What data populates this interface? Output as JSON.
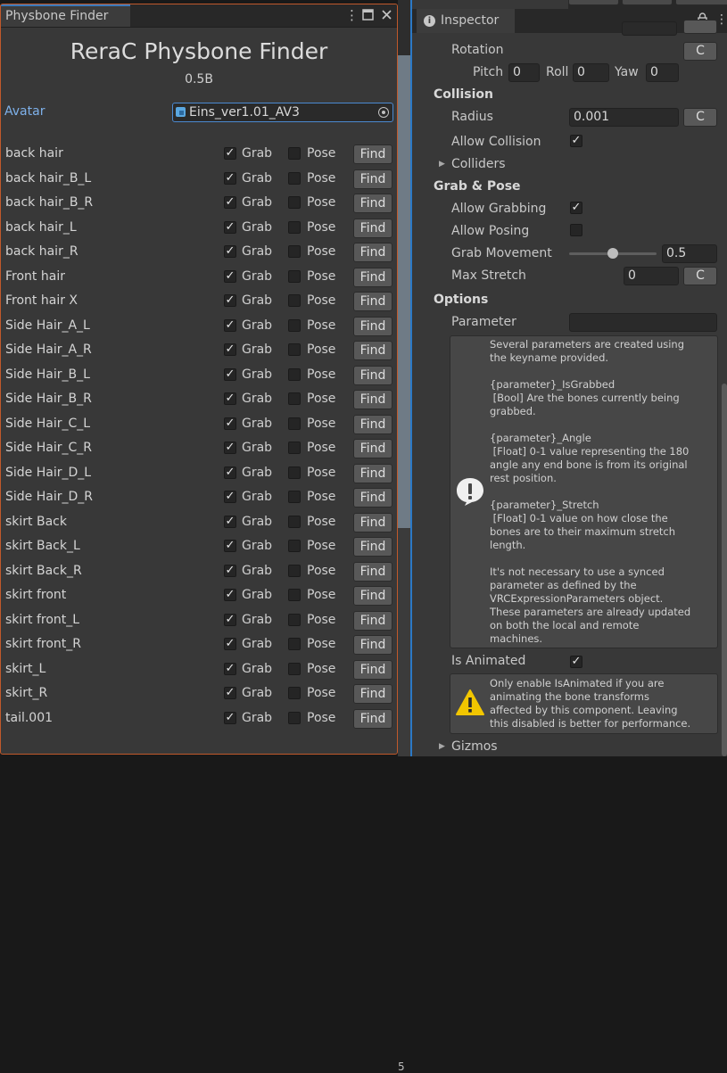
{
  "finder": {
    "tab_title": "Physbone Finder",
    "title": "ReraC Physbone Finder",
    "version": "0.5B",
    "avatar_label": "Avatar",
    "avatar_value": "Eins_ver1.01_AV3",
    "grab_label": "Grab",
    "pose_label": "Pose",
    "find_label": "Find",
    "check_glyph": "✓",
    "rows": [
      {
        "name": "back hair",
        "grab": true,
        "pose": false
      },
      {
        "name": "back hair_B_L",
        "grab": true,
        "pose": false
      },
      {
        "name": "back hair_B_R",
        "grab": true,
        "pose": false
      },
      {
        "name": "back hair_L",
        "grab": true,
        "pose": false
      },
      {
        "name": "back hair_R",
        "grab": true,
        "pose": false
      },
      {
        "name": "Front hair",
        "grab": true,
        "pose": false
      },
      {
        "name": "Front hair X",
        "grab": true,
        "pose": false
      },
      {
        "name": "Side Hair_A_L",
        "grab": true,
        "pose": false
      },
      {
        "name": "Side Hair_A_R",
        "grab": true,
        "pose": false
      },
      {
        "name": "Side Hair_B_L",
        "grab": true,
        "pose": false
      },
      {
        "name": "Side Hair_B_R",
        "grab": true,
        "pose": false
      },
      {
        "name": "Side Hair_C_L",
        "grab": true,
        "pose": false
      },
      {
        "name": "Side Hair_C_R",
        "grab": true,
        "pose": false
      },
      {
        "name": "Side Hair_D_L",
        "grab": true,
        "pose": false
      },
      {
        "name": "Side Hair_D_R",
        "grab": true,
        "pose": false
      },
      {
        "name": "skirt Back",
        "grab": true,
        "pose": false
      },
      {
        "name": "skirt Back_L",
        "grab": true,
        "pose": false
      },
      {
        "name": "skirt Back_R",
        "grab": true,
        "pose": false
      },
      {
        "name": "skirt front",
        "grab": true,
        "pose": false
      },
      {
        "name": "skirt front_L",
        "grab": true,
        "pose": false
      },
      {
        "name": "skirt front_R",
        "grab": true,
        "pose": false
      },
      {
        "name": "skirt_L",
        "grab": true,
        "pose": false
      },
      {
        "name": "skirt_R",
        "grab": true,
        "pose": false
      },
      {
        "name": "tail.001",
        "grab": true,
        "pose": false
      }
    ]
  },
  "scene": {
    "partial_digit": "5"
  },
  "inspector": {
    "tab_title": "Inspector",
    "rotation_label": "Rotation",
    "pitch_label": "Pitch",
    "pitch_value": "0",
    "roll_label": "Roll",
    "roll_value": "0",
    "yaw_label": "Yaw",
    "yaw_value": "0",
    "curve_button": "C",
    "collision_header": "Collision",
    "radius_label": "Radius",
    "radius_value": "0.001",
    "allow_collision_label": "Allow Collision",
    "allow_collision": true,
    "colliders_label": "Colliders",
    "grab_pose_header": "Grab & Pose",
    "allow_grabbing_label": "Allow Grabbing",
    "allow_grabbing": true,
    "allow_posing_label": "Allow Posing",
    "allow_posing": false,
    "grab_movement_label": "Grab Movement",
    "grab_movement_value": "0.5",
    "grab_movement": 0.5,
    "max_stretch_label": "Max Stretch",
    "max_stretch_value": "0",
    "options_header": "Options",
    "parameter_label": "Parameter",
    "parameter_value": "",
    "parameter_help": "Several parameters are created using\nthe keyname provided.\n\n{parameter}_IsGrabbed\n [Bool] Are the bones currently being\ngrabbed.\n\n{parameter}_Angle\n [Float] 0-1 value representing the 180\nangle any end bone is from its original\nrest position.\n\n{parameter}_Stretch\n [Float] 0-1 value on how close the\nbones are to their maximum stretch\nlength.\n\nIt's not necessary to use a synced\nparameter as defined by the\nVRCExpressionParameters object.\nThese parameters are already updated\non both the local and remote\nmachines.",
    "is_animated_label": "Is Animated",
    "is_animated": true,
    "is_animated_help": "Only enable IsAnimated if you are\nanimating the bone transforms\naffected by this component. Leaving\nthis disabled is better for performance.",
    "gizmos_label": "Gizmos"
  }
}
